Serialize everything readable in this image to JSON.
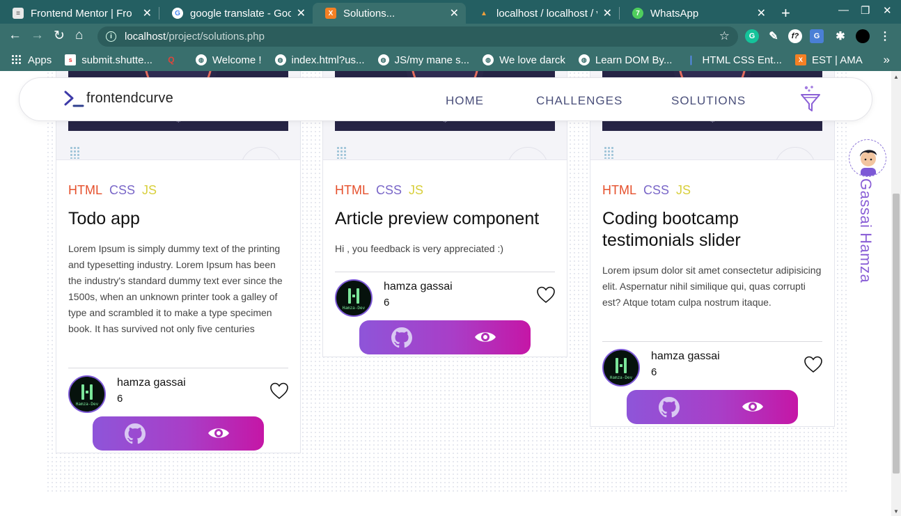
{
  "browser": {
    "tabs": [
      {
        "title": "Frontend Mentor | Fro",
        "favicon": "document-icon"
      },
      {
        "title": "google translate - Goo",
        "favicon": "google-icon"
      },
      {
        "title": "Solutions...",
        "favicon": "xampp-icon"
      },
      {
        "title": "localhost / localhost / v",
        "favicon": "phpmyadmin-icon"
      },
      {
        "title": "WhatsApp",
        "favicon": "whatsapp-icon"
      }
    ],
    "url_host": "localhost",
    "url_path": "/project/solutions.php",
    "bookmarks": [
      {
        "label": "Apps",
        "icon": "apps-grid-icon"
      },
      {
        "label": "submit.shutte...",
        "icon": "shutterstock-icon"
      },
      {
        "label": "",
        "icon": "q-icon"
      },
      {
        "label": "Welcome !",
        "icon": "globe-icon"
      },
      {
        "label": "index.html?us...",
        "icon": "globe-icon"
      },
      {
        "label": "JS/my mane s...",
        "icon": "globe-icon"
      },
      {
        "label": "We love darck",
        "icon": "globe-icon"
      },
      {
        "label": "Learn DOM By...",
        "icon": "globe-icon"
      },
      {
        "label": "HTML CSS Ent...",
        "icon": "bookmark-icon"
      },
      {
        "label": "EST | AMA",
        "icon": "xampp-icon"
      }
    ]
  },
  "header": {
    "logo": "frontendcurve",
    "nav": [
      "HOME",
      "CHALLENGES",
      "SOLUTIONS"
    ]
  },
  "sidebar_profile": {
    "name": "Gassai Hamza"
  },
  "cards": [
    {
      "tags": [
        "HTML",
        "CSS",
        "JS"
      ],
      "title": "Todo app",
      "description": "Lorem Ipsum is simply dummy text of the printing and typesetting industry. Lorem Ipsum has been the industry's standard dummy text ever since the 1500s, when an unknown printer took a galley of type and scrambled it to make a type specimen book. It has survived not only five centuries",
      "author": "hamza gassai",
      "likes": "6"
    },
    {
      "tags": [
        "HTML",
        "CSS",
        "JS"
      ],
      "title": "Article preview component",
      "description": "Hi , you feedback is very appreciated :)",
      "author": "hamza gassai",
      "likes": "6"
    },
    {
      "tags": [
        "HTML",
        "CSS",
        "JS"
      ],
      "title": "Coding bootcamp testimonials slider",
      "description": "Lorem ipsum dolor sit amet consectetur adipisicing elit. Aspernatur nihil similique qui, quas corrupti est? Atque totam culpa nostrum itaque.",
      "author": "hamza gassai",
      "likes": "6"
    }
  ],
  "avatar_text": "Hamza-Dev",
  "colors": {
    "tag_html": "#e5502c",
    "tag_css": "#7a67c8",
    "tag_js": "#d8cf3b",
    "action_gradient_start": "#8e55d9",
    "action_gradient_end": "#c516a6",
    "accent_purple": "#8a5fd6"
  }
}
